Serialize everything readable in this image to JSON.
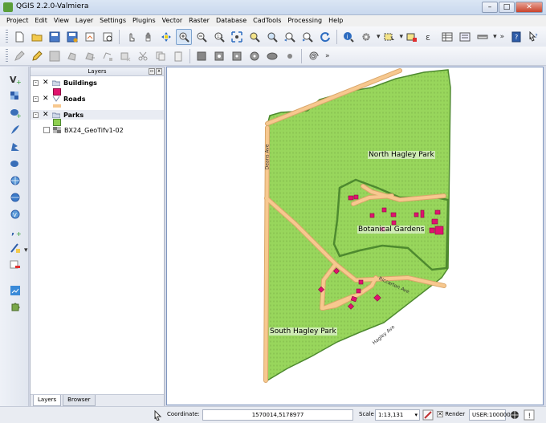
{
  "window": {
    "title": "QGIS 2.2.0-Valmiera"
  },
  "menu": [
    "Project",
    "Edit",
    "View",
    "Layer",
    "Settings",
    "Plugins",
    "Vector",
    "Raster",
    "Database",
    "CadTools",
    "Processing",
    "Help"
  ],
  "layers_panel": {
    "title": "Layers",
    "layers": [
      {
        "name": "Buildings",
        "checked": true,
        "swatch_color": "#e0136f"
      },
      {
        "name": "Roads",
        "checked": true,
        "swatch_color": "#f7c88f"
      },
      {
        "name": "Parks",
        "checked": true,
        "swatch_color": "#8fd050"
      },
      {
        "name": "BX24_GeoTifv1-02",
        "checked": false
      }
    ],
    "tabs": [
      "Layers",
      "Browser"
    ]
  },
  "map": {
    "colors": {
      "park": "#98d65c",
      "park_border": "#4e8a2f",
      "road": "#f7c88f",
      "road_edge": "#d9a66a",
      "building": "#e0136f",
      "building_edge": "#8a0a42"
    },
    "labels": {
      "north_park": "North Hagley Park",
      "botanical": "Botanical Gardens",
      "south_park": "South Hagley Park",
      "deans_ave": "Deans Ave",
      "riccarton_ave": "Riccarton Ave",
      "hagley_ave": "Hagley Ave"
    }
  },
  "status": {
    "coordinate_label": "Coordinate:",
    "coordinate_value": "1570014,5178977",
    "scale_label": "Scale",
    "scale_value": "1:13,131",
    "render_label": "Render",
    "render_checked": true,
    "crs": "USER:100000"
  }
}
